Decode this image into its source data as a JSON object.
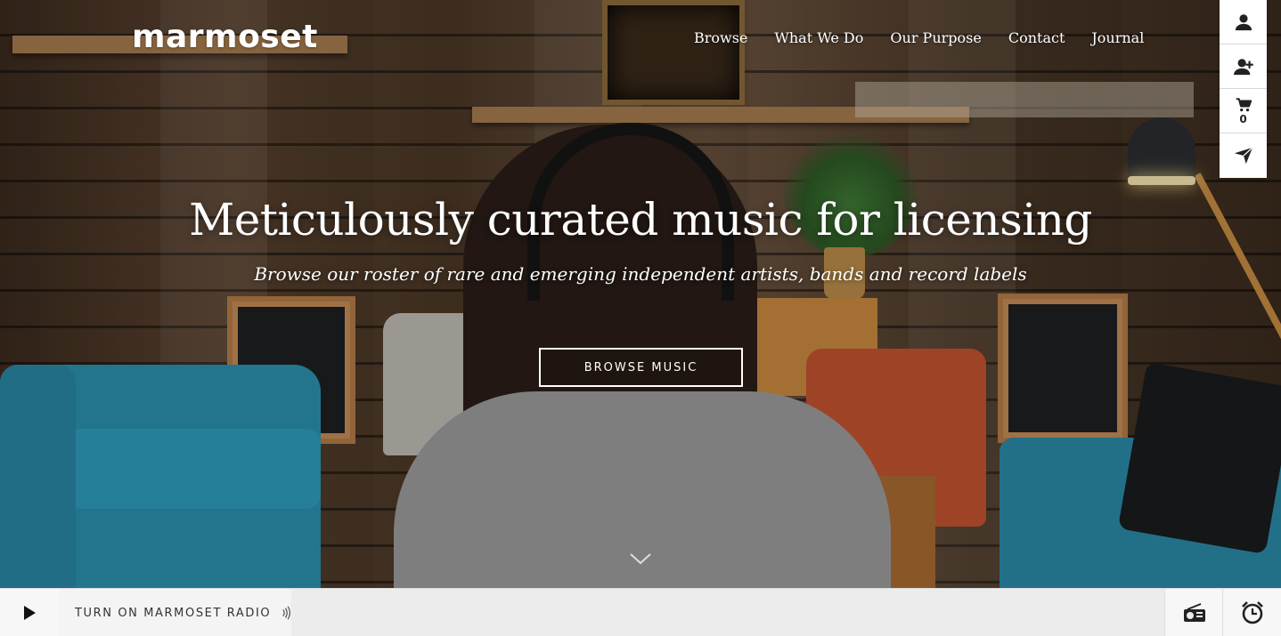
{
  "brand": {
    "logo_text": "marmoset"
  },
  "nav": {
    "items": [
      {
        "label": "Browse"
      },
      {
        "label": "What We Do"
      },
      {
        "label": "Our Purpose"
      },
      {
        "label": "Contact"
      },
      {
        "label": "Journal"
      }
    ]
  },
  "side_tools": {
    "cart_count": "0",
    "icons": [
      "user-icon",
      "add-user-icon",
      "cart-icon",
      "send-icon"
    ]
  },
  "hero": {
    "headline": "Meticulously curated music for licensing",
    "subhead": "Browse our roster of rare and emerging independent artists, bands and record labels",
    "cta_label": "BROWSE MUSIC"
  },
  "radio_bar": {
    "label": "TURN ON MARMOSET RADIO",
    "icons": [
      "play-icon",
      "radio-waves-icon",
      "radio-icon",
      "alarm-clock-icon"
    ]
  },
  "colors": {
    "sofa_blue": "#2b8fae",
    "chair_red": "#c2522f",
    "bar_bg": "#ececec"
  }
}
